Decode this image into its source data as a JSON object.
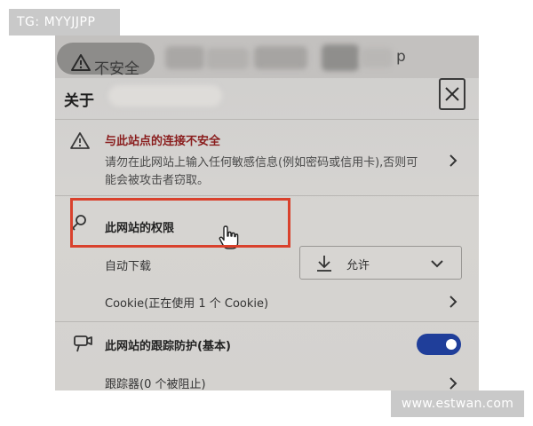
{
  "watermarks": {
    "top_left": "TG: MYYJJPP",
    "bottom_right": "www.estwan.com"
  },
  "address_bar": {
    "security_label": "不安全",
    "url_tail": "p"
  },
  "panel": {
    "title": "关于",
    "connection": {
      "title": "与此站点的连接不安全",
      "description": "请勿在此网站上输入任何敏感信息(例如密码或信用卡),否则可能会被攻击者窃取。"
    },
    "permissions": {
      "title": "此网站的权限",
      "auto_download": {
        "label": "自动下载",
        "value": "允许"
      },
      "cookie_label": "Cookie(正在使用 1 个 Cookie)"
    },
    "tracking": {
      "title": "此网站的跟踪防护(基本)",
      "enabled": true,
      "trackers_label": "跟踪器(0 个被阻止)"
    }
  },
  "colors": {
    "warning_red": "#8a1d1d",
    "highlight_red": "#d9412c",
    "toggle_blue": "#1f3e9a"
  },
  "icons": {
    "security": "warning-triangle-icon",
    "close": "close-icon",
    "permissions": "key-icon",
    "download": "download-icon",
    "tracking": "tracking-prevention-icon",
    "cursor": "hand-pointer-icon",
    "chevron": "chevron-right-icon",
    "dropdown": "chevron-down-icon"
  }
}
